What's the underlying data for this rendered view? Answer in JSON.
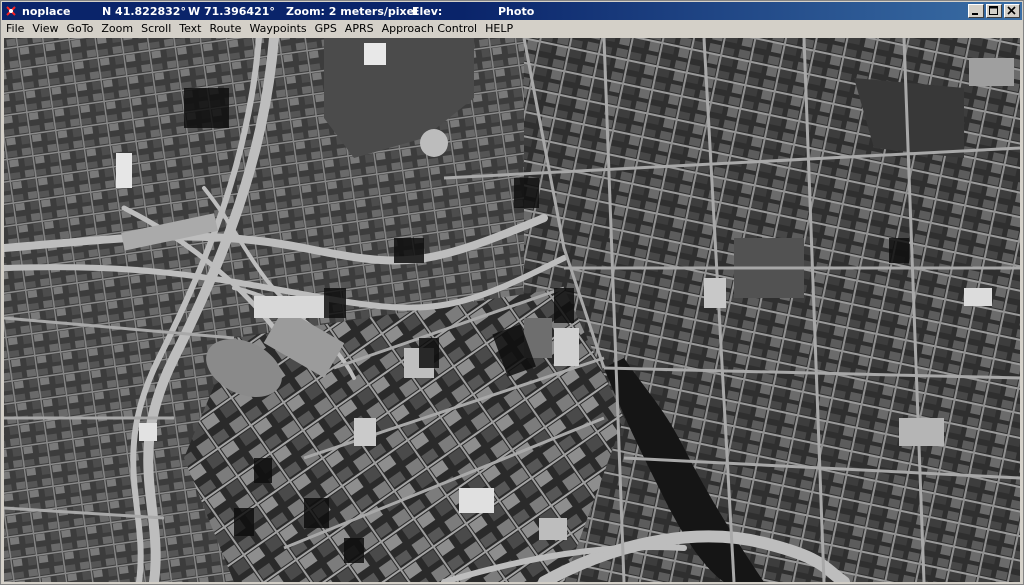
{
  "window": {
    "title": "noplace",
    "latitude": "N 41.822832°",
    "longitude": "W 71.396421°",
    "zoom": "Zoom: 2 meters/pixel",
    "elev": "Elev:",
    "layer": "Photo",
    "controls": {
      "minimize_icon": "minimize-icon",
      "maximize_icon": "maximize-icon",
      "close_icon": "close-icon"
    }
  },
  "menu": {
    "items": [
      {
        "label": "File"
      },
      {
        "label": "View"
      },
      {
        "label": "GoTo"
      },
      {
        "label": "Zoom"
      },
      {
        "label": "Scroll"
      },
      {
        "label": "Text"
      },
      {
        "label": "Route"
      },
      {
        "label": "Waypoints"
      },
      {
        "label": "GPS"
      },
      {
        "label": "APRS"
      },
      {
        "label": "Approach Control"
      },
      {
        "label": "HELP"
      }
    ]
  },
  "map": {
    "type": "grayscale aerial photo",
    "colors": {
      "background": "#3a3a3a",
      "accent_titlebar": "#0a246a"
    }
  }
}
